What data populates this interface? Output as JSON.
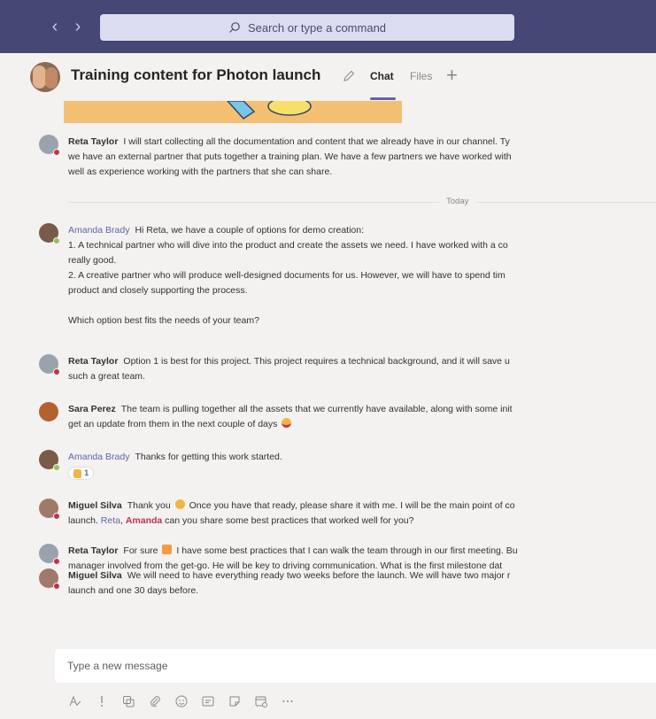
{
  "search": {
    "placeholder": "Search or type a command"
  },
  "header": {
    "title": "Training content for Photon launch",
    "tabs": [
      {
        "label": "Chat"
      },
      {
        "label": "Files"
      }
    ]
  },
  "divider": {
    "label": "Today"
  },
  "messages": [
    {
      "author": "Reta Taylor",
      "lines": [
        "I will start collecting all the documentation and content that we already have in our channel. Ty",
        "we have an external partner that puts together a training plan. We have a few partners we have worked with",
        "well as experience working with the partners that she can share."
      ]
    },
    {
      "author": "Amanda Brady",
      "lines": [
        "Hi Reta, we have a couple of options for demo creation:",
        "1. A technical partner who will dive into the product and create the assets we need. I have worked with a co",
        "really good.",
        "2. A creative partner who will produce well-designed documents for us. However, we will have to spend tim",
        "product and closely supporting the process.",
        "",
        "Which option best fits the needs of your team?"
      ]
    },
    {
      "author": "Reta Taylor",
      "lines": [
        "Option 1 is best for this project. This project requires a technical background, and it will save u",
        "such a great team."
      ]
    },
    {
      "author": "Sara Perez",
      "lines": [
        "The team is pulling together all the assets that we currently have available, along with some init",
        "get an update from them in the next couple of days"
      ]
    },
    {
      "author": "Amanda Brady",
      "lines": [
        "Thanks for getting this work started."
      ],
      "reaction": {
        "count": "1"
      }
    },
    {
      "author": "Miguel Silva",
      "lines": [
        "Thank you",
        "Once you have that ready, please share it with me. I will be the main point of co",
        "launch.",
        "can you share some best practices that worked well for you?"
      ],
      "mentions": [
        "Reta",
        "Amanda"
      ]
    },
    {
      "author": "Reta Taylor",
      "lines": [
        "For sure",
        "I have some best practices that I can walk the team through in our first meeting. Bu",
        "manager involved from the get-go. He will be key to driving communication. What is the first milestone dat"
      ]
    },
    {
      "author": "Miguel Silva",
      "lines": [
        "We will need to have everything ready two weeks before the launch. We will have two major r",
        "launch and one 30 days before."
      ]
    }
  ],
  "compose": {
    "placeholder": "Type a new message"
  },
  "colors": {
    "titlebar": "#464775",
    "accent": "#6264a7",
    "mention": "#c4314b",
    "presence_available": "#92c353"
  }
}
